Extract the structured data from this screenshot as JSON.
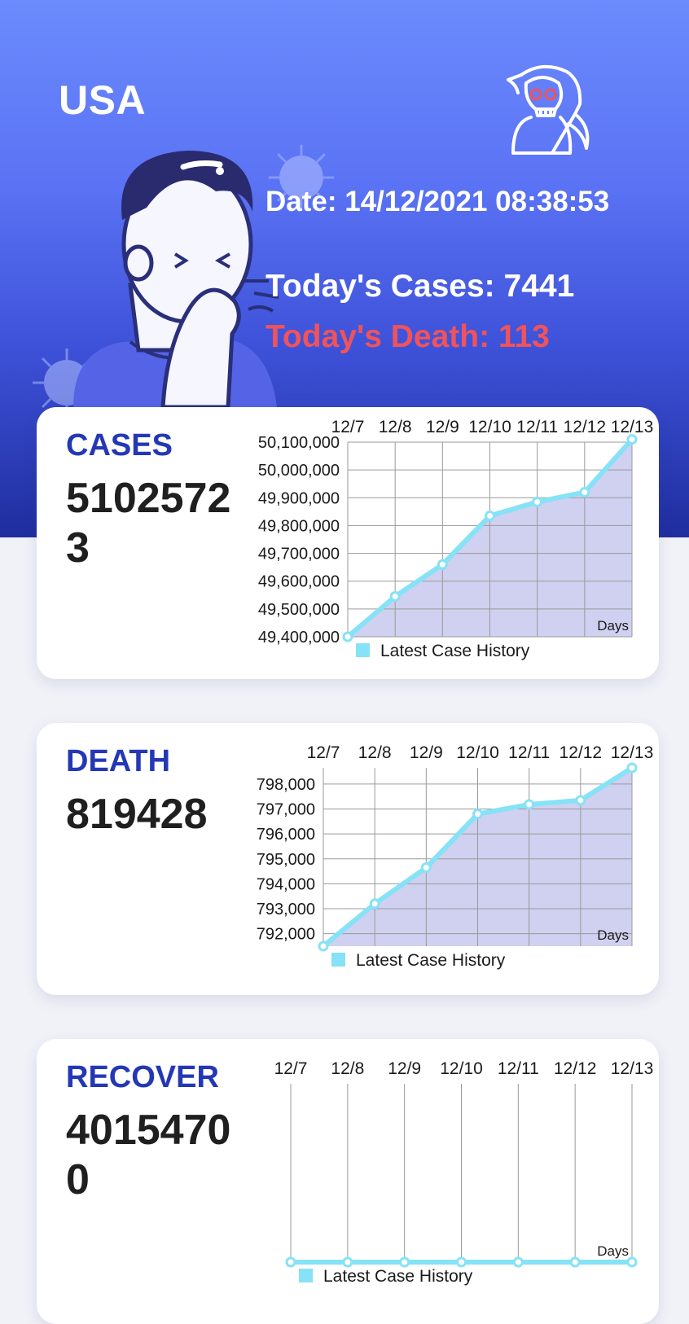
{
  "header": {
    "country": "USA",
    "date_text": "Date: 14/12/2021 08:38:53",
    "todays_cases_text": "Today's Cases: 7441",
    "todays_death_text": "Today's Death: 113",
    "icons": [
      "grim-reaper-icon",
      "sneezing-person-illustration",
      "virus-icon"
    ]
  },
  "cards": {
    "cases": {
      "title": "CASES",
      "value": "51025723"
    },
    "death": {
      "title": "DEATH",
      "value": "819428"
    },
    "recover": {
      "title": "RECOVER",
      "value": "40154700"
    }
  },
  "colors": {
    "accent": "#2438b5",
    "line": "#86e2f7",
    "area": "#d0d0f0",
    "death_red": "#f0535b"
  },
  "chart_data": [
    {
      "type": "area",
      "x": [
        "12/7",
        "12/8",
        "12/9",
        "12/10",
        "12/11",
        "12/12",
        "12/13"
      ],
      "series": [
        {
          "name": "Latest Case History",
          "values": [
            49400000,
            49545000,
            49660000,
            49835000,
            49885000,
            49920000,
            50110000
          ]
        }
      ],
      "ylim": [
        49400000,
        50100000
      ],
      "yticks": [
        50100000,
        50000000,
        49900000,
        49800000,
        49700000,
        49600000,
        49500000,
        49400000
      ],
      "yticks_text": [
        "50,100,000",
        "50,000,000",
        "49,900,000",
        "49,800,000",
        "49,700,000",
        "49,600,000",
        "49,500,000",
        "49,400,000"
      ],
      "xlabel": "Days",
      "legend": "bottom",
      "grid": true
    },
    {
      "type": "area",
      "x": [
        "12/7",
        "12/8",
        "12/9",
        "12/10",
        "12/11",
        "12/12",
        "12/13"
      ],
      "series": [
        {
          "name": "Latest Case History",
          "values": [
            791500,
            793200,
            794650,
            796800,
            797180,
            797350,
            798650
          ]
        }
      ],
      "ylim": [
        791500,
        798650
      ],
      "yticks": [
        798000,
        797000,
        796000,
        795000,
        794000,
        793000,
        792000
      ],
      "yticks_text": [
        "798,000",
        "797,000",
        "796,000",
        "795,000",
        "794,000",
        "793,000",
        "792,000"
      ],
      "xlabel": "Days",
      "legend": "bottom",
      "grid": true
    },
    {
      "type": "area",
      "x": [
        "12/7",
        "12/8",
        "12/9",
        "12/10",
        "12/11",
        "12/12",
        "12/13"
      ],
      "series": [
        {
          "name": "Latest Case History",
          "values": [
            0,
            0,
            0,
            0,
            0,
            0,
            0
          ]
        }
      ],
      "ylim": [
        0,
        1
      ],
      "yticks": [],
      "yticks_text": [],
      "xlabel": "Days",
      "legend": "bottom",
      "grid": true
    }
  ]
}
